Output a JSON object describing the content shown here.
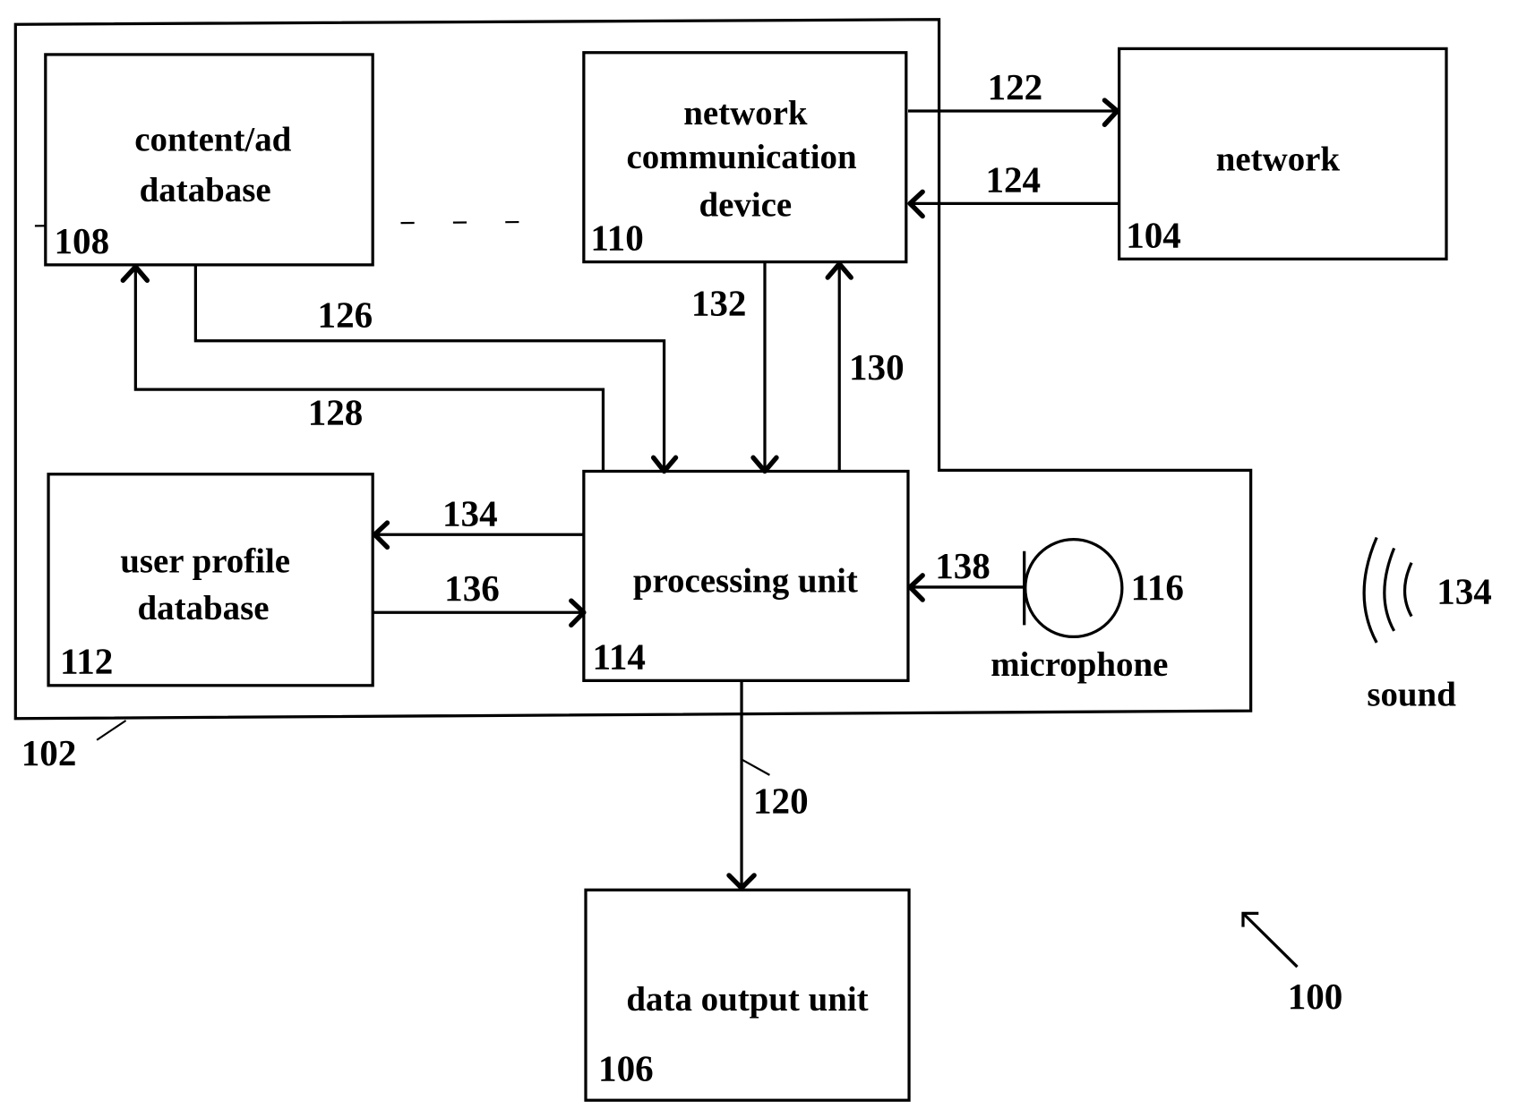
{
  "figure": {
    "ref": "100",
    "system_ref": "102"
  },
  "blocks": {
    "content_db": {
      "lines": [
        "content/ad",
        "database"
      ],
      "ref": "108"
    },
    "network_comm": {
      "lines": [
        "network",
        "communication",
        "device"
      ],
      "ref": "110"
    },
    "network": {
      "lines": [
        "network"
      ],
      "ref": "104"
    },
    "user_profile_db": {
      "lines": [
        "user profile",
        "database"
      ],
      "ref": "112"
    },
    "processing_unit": {
      "lines": [
        "processing unit"
      ],
      "ref": "114"
    },
    "data_output": {
      "lines": [
        "data output unit"
      ],
      "ref": "106"
    },
    "microphone": {
      "label": "microphone",
      "ref": "116"
    },
    "sound": {
      "label": "sound",
      "ref": "134"
    }
  },
  "connections": {
    "c122": "122",
    "c124": "124",
    "c126": "126",
    "c128": "128",
    "c130": "130",
    "c132": "132",
    "c134": "134",
    "c136": "136",
    "c138": "138",
    "c120": "120"
  }
}
